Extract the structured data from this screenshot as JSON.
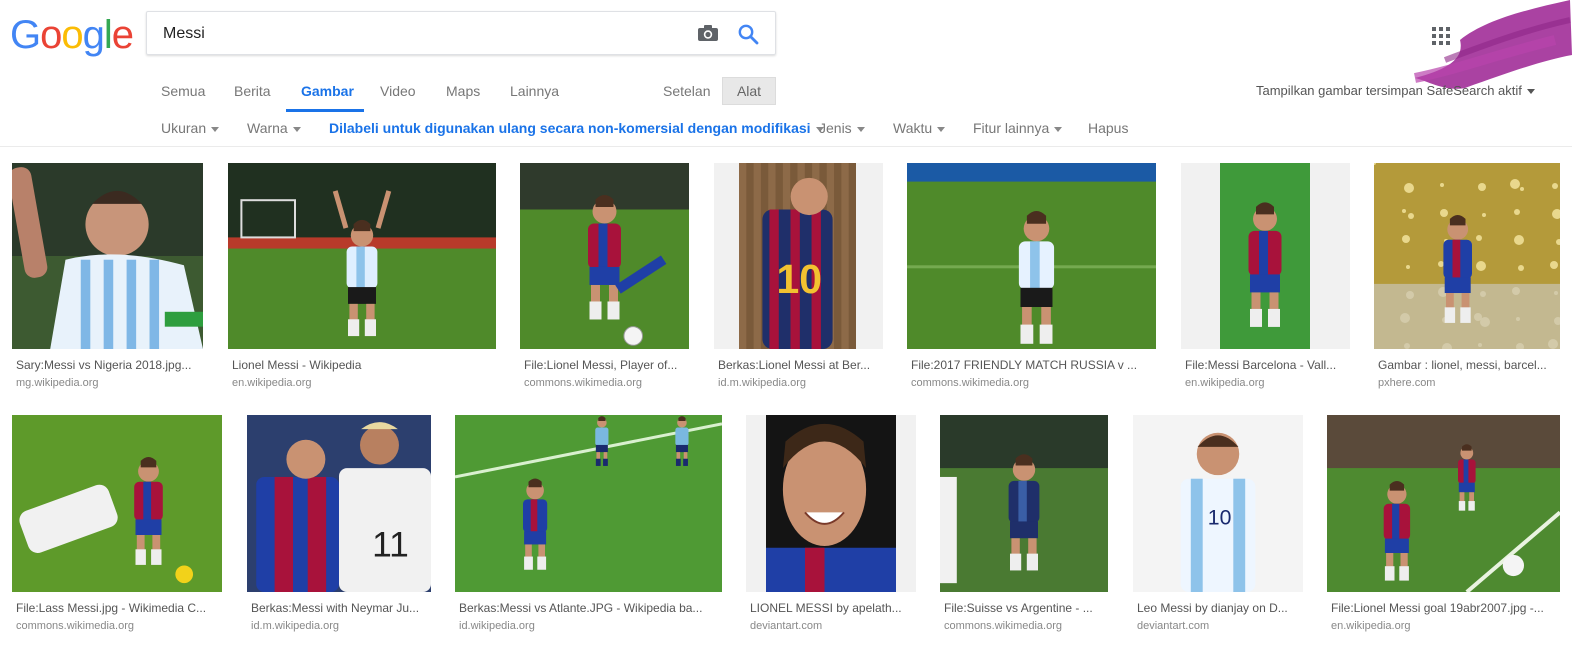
{
  "logo": {
    "text": "Google"
  },
  "search": {
    "query": "Messi"
  },
  "tabs": {
    "all": "Semua",
    "news": "Berita",
    "images": "Gambar",
    "video": "Video",
    "maps": "Maps",
    "more": "Lainnya",
    "settings": "Setelan",
    "tools": "Alat"
  },
  "safesearch": {
    "text": "Tampilkan gambar tersimpan   SafeSearch aktif"
  },
  "filters": {
    "size": "Ukuran",
    "color": "Warna",
    "usage_rights": "Dilabeli untuk digunakan ulang secara non-komersial dengan modifikasi",
    "type": "Jenis",
    "time": "Waktu",
    "more_tools": "Fitur lainnya",
    "clear": "Hapus"
  },
  "colors": {
    "accent": "#1a73e8",
    "tools_bg": "#e8e8e8"
  },
  "results": [
    {
      "caption": "Sary:Messi vs Nigeria 2018.jpg...",
      "domain": "mg.wikipedia.org"
    },
    {
      "caption": "Lionel Messi - Wikipedia",
      "domain": "en.wikipedia.org"
    },
    {
      "caption": "File:Lionel Messi, Player of...",
      "domain": "commons.wikimedia.org"
    },
    {
      "caption": "Berkas:Lionel Messi at Ber...",
      "domain": "id.m.wikipedia.org"
    },
    {
      "caption": "File:2017 FRIENDLY MATCH RUSSIA v ...",
      "domain": "commons.wikimedia.org"
    },
    {
      "caption": "File:Messi Barcelona - Vall...",
      "domain": "en.wikipedia.org"
    },
    {
      "caption": "Gambar : lionel, messi, barcel...",
      "domain": "pxhere.com"
    },
    {
      "caption": "File:Lass Messi.jpg - Wikimedia C...",
      "domain": "commons.wikimedia.org"
    },
    {
      "caption": "Berkas:Messi with Neymar Ju...",
      "domain": "id.m.wikipedia.org"
    },
    {
      "caption": "Berkas:Messi vs Atlante.JPG - Wikipedia ba...",
      "domain": "id.wikipedia.org"
    },
    {
      "caption": "LIONEL MESSI by apelath...",
      "domain": "deviantart.com"
    },
    {
      "caption": "File:Suisse vs Argentine - ...",
      "domain": "commons.wikimedia.org"
    },
    {
      "caption": "Leo Messi by dianjay on D...",
      "domain": "deviantart.com"
    },
    {
      "caption": "File:Lionel Messi goal 19abr2007.jpg -...",
      "domain": "en.wikipedia.org"
    }
  ]
}
